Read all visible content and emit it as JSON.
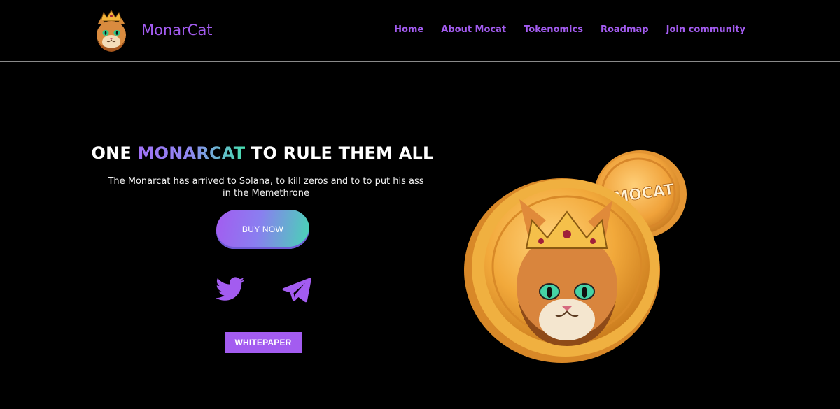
{
  "header": {
    "brand": "MonarCat",
    "logo_icon": "crowned-cat-logo-icon",
    "nav": [
      {
        "label": "Home"
      },
      {
        "label": "About Mocat"
      },
      {
        "label": "Tokenomics"
      },
      {
        "label": "Roadmap"
      },
      {
        "label": "Join community"
      }
    ]
  },
  "hero": {
    "title_prefix": "ONE ",
    "title_accent": "MONARCAT",
    "title_suffix": " TO RULE THEM ALL",
    "subtitle": "The Monarcat has arrived to Solana, to kill zeros and to to put his ass in the Memethrone",
    "buy_label": "BUY NOW",
    "whitepaper_label": "WHITEPAPER",
    "social": [
      {
        "icon": "twitter-bird-icon"
      },
      {
        "icon": "telegram-plane-icon"
      }
    ]
  },
  "coin": {
    "small_coin_text": "$MOCAT",
    "illustration_icon": "mocat-coin-illustration-icon"
  },
  "colors": {
    "accent": "#a35cf0",
    "gradient_end": "#47d6b4",
    "background": "#000000",
    "coin_gold": "#f2a93b"
  }
}
